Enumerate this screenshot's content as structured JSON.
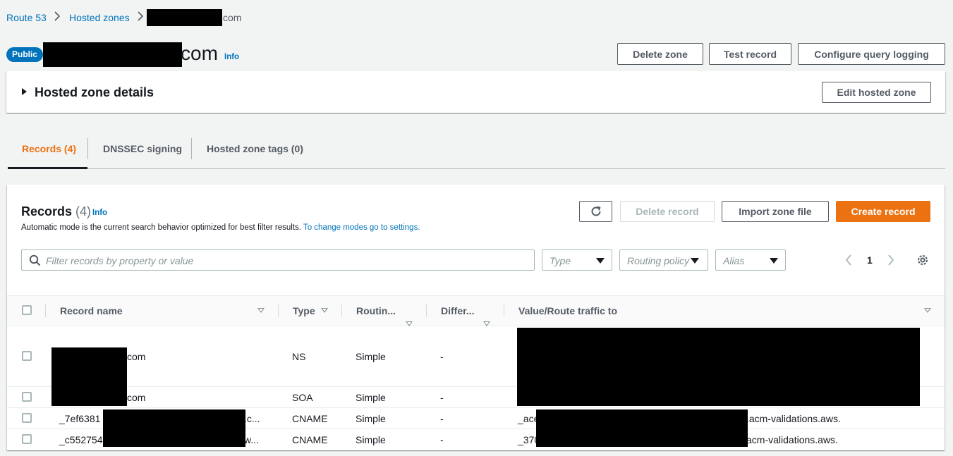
{
  "breadcrumb": {
    "route53": "Route 53",
    "hosted_zones": "Hosted zones",
    "zone_suffix": "com"
  },
  "header": {
    "badge": "Public",
    "zone_suffix": "com",
    "info": "Info",
    "delete_zone": "Delete zone",
    "test_record": "Test record",
    "configure_logging": "Configure query logging"
  },
  "details": {
    "title": "Hosted zone details",
    "edit": "Edit hosted zone"
  },
  "tabs": [
    {
      "label": "Records (4)",
      "active": true
    },
    {
      "label": "DNSSEC signing",
      "active": false
    },
    {
      "label": "Hosted zone tags (0)",
      "active": false
    }
  ],
  "records": {
    "title": "Records",
    "count": "(4)",
    "info": "Info",
    "subtitle": "Automatic mode is the current search behavior optimized for best filter results.",
    "subtitle_link": "To change modes go to settings.",
    "delete_record": "Delete record",
    "import_zone": "Import zone file",
    "create_record": "Create record",
    "search_placeholder": "Filter records by property or value",
    "filter_type": "Type",
    "filter_routing": "Routing policy",
    "filter_alias": "Alias",
    "page": "1"
  },
  "table": {
    "columns": [
      "Record name",
      "Type",
      "Routin...",
      "Differ...",
      "Value/Route traffic to"
    ],
    "rows": [
      {
        "name": "com",
        "type": "NS",
        "routing": "Simple",
        "diff": "-",
        "value": ""
      },
      {
        "name": "com",
        "type": "SOA",
        "routing": "Simple",
        "diff": "-",
        "value": ""
      },
      {
        "name_prefix": "_7ef6381",
        "name_suffix": ".c...",
        "type": "CNAME",
        "routing": "Simple",
        "diff": "-",
        "value_prefix": "_ace",
        "value_suffix": ".acm-validations.aws."
      },
      {
        "name_prefix": "_c552754",
        "name_suffix": "w...",
        "type": "CNAME",
        "routing": "Simple",
        "diff": "-",
        "value_prefix": "_370",
        "value_suffix": "acm-validations.aws."
      }
    ]
  },
  "colors": {
    "link": "#0073bb",
    "primary": "#ec7211",
    "text": "#16191f",
    "muted": "#545b64"
  }
}
